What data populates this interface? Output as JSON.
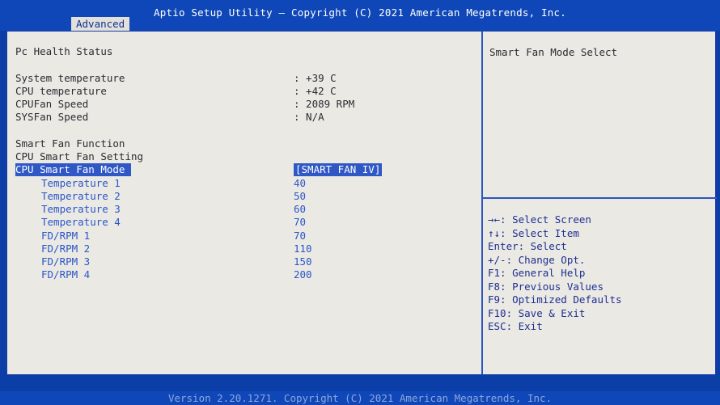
{
  "header": {
    "title": "Aptio Setup Utility – Copyright (C) 2021 American Megatrends, Inc.",
    "active_tab": "Advanced"
  },
  "left": {
    "section_title": "Pc Health Status",
    "status_rows": [
      {
        "label": "System temperature",
        "value": ": +39 C"
      },
      {
        "label": "CPU temperature",
        "value": ": +42 C"
      },
      {
        "label": "CPUFan Speed",
        "value": ": 2089 RPM"
      },
      {
        "label": "SYSFan Speed",
        "value": ": N/A"
      }
    ],
    "smart_fan_function": "Smart Fan Function",
    "cpu_smart_fan_setting": "CPU Smart Fan Setting",
    "selected_option": {
      "label": "CPU Smart Fan Mode",
      "value": "[SMART FAN IV]"
    },
    "settings": [
      {
        "label": "Temperature 1",
        "value": "40"
      },
      {
        "label": "Temperature 2",
        "value": "50"
      },
      {
        "label": "Temperature 3",
        "value": "60"
      },
      {
        "label": "Temperature 4",
        "value": "70"
      },
      {
        "label": "FD/RPM 1",
        "value": "70"
      },
      {
        "label": "FD/RPM 2",
        "value": "110"
      },
      {
        "label": "FD/RPM 3",
        "value": "150"
      },
      {
        "label": "FD/RPM 4",
        "value": "200"
      }
    ]
  },
  "help": {
    "title": "Smart Fan Mode Select",
    "keys": [
      "→←: Select Screen",
      "↑↓: Select Item",
      "Enter: Select",
      "+/-: Change Opt.",
      "F1: General Help",
      "F8: Previous Values",
      "F9: Optimized Defaults",
      "F10: Save & Exit",
      "ESC: Exit"
    ]
  },
  "footer": {
    "text": "Version 2.20.1271. Copyright (C) 2021 American Megatrends, Inc."
  },
  "colors": {
    "background": "#0c3ea8",
    "panel": "#ebe9e4",
    "selection": "#2f58c6",
    "option_text": "#2a56c8",
    "help_text": "#1d2f8f"
  }
}
